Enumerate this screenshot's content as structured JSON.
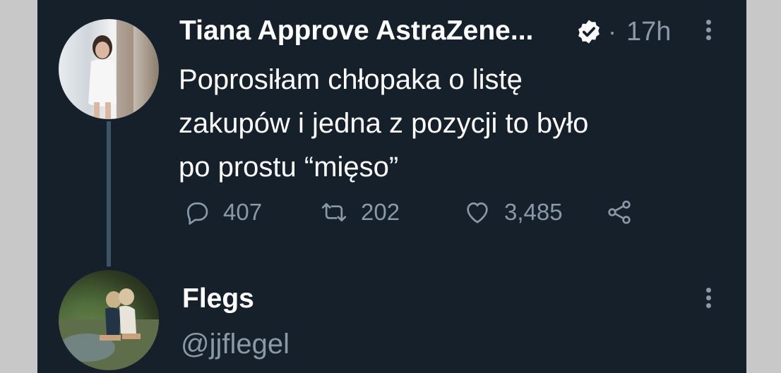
{
  "tweet": {
    "author_name": "Tiana Approve AstraZene...",
    "separator": "·",
    "timestamp": "17h",
    "text_lines": [
      "Poprosiłam chłopaka o listę",
      "zakupów i jedna z pozycji to było",
      "po prostu “mięso”"
    ],
    "reply_count": "407",
    "retweet_count": "202",
    "like_count": "3,485",
    "verified_icon": "verified-badge-icon"
  },
  "reply": {
    "author_name": "Flegs",
    "handle": "@jjflegel"
  },
  "colors": {
    "background": "#15202b",
    "text": "#ffffff",
    "muted": "#8b98a5",
    "thread_line": "#3d5466"
  }
}
